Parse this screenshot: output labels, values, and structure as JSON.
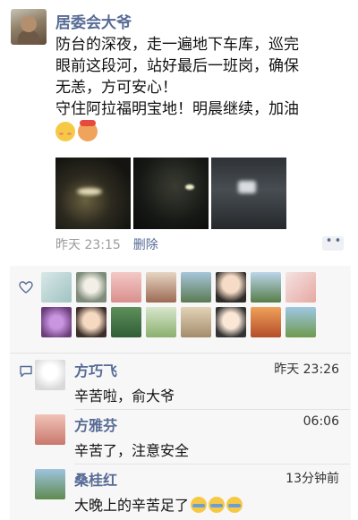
{
  "post": {
    "author": "居委会大爷",
    "text_lines": [
      "防台的深夜，走一遍地下车库，巡完",
      "眼前这段河，站好最后一班岗，确保",
      "无恙，方可安心！",
      "守住阿拉福明宝地！明晨继续，加油"
    ],
    "emojis": [
      "blush-emoji",
      "cheer-emoji"
    ],
    "photos": [
      "night-garage-photo",
      "night-river-photo",
      "garage-entrance-photo"
    ],
    "time": "昨天 23:15",
    "delete_label": "删除",
    "more_icon": "more-dots-icon"
  },
  "likes": {
    "icon": "heart-icon",
    "count_avatars": 16
  },
  "comments": {
    "icon": "comment-icon",
    "items": [
      {
        "name": "方巧飞",
        "time": "昨天 23:26",
        "text": "辛苦啦，俞大爷"
      },
      {
        "name": "方雅芬",
        "time": "06:06",
        "text": "辛苦了，注意安全"
      },
      {
        "name": "桑桂红",
        "time": "13分钟前",
        "text": "大晚上的辛苦足了"
      }
    ]
  },
  "colors": {
    "link": "#576b95",
    "panel": "#f7f7f7",
    "meta": "#9b9b9b"
  }
}
